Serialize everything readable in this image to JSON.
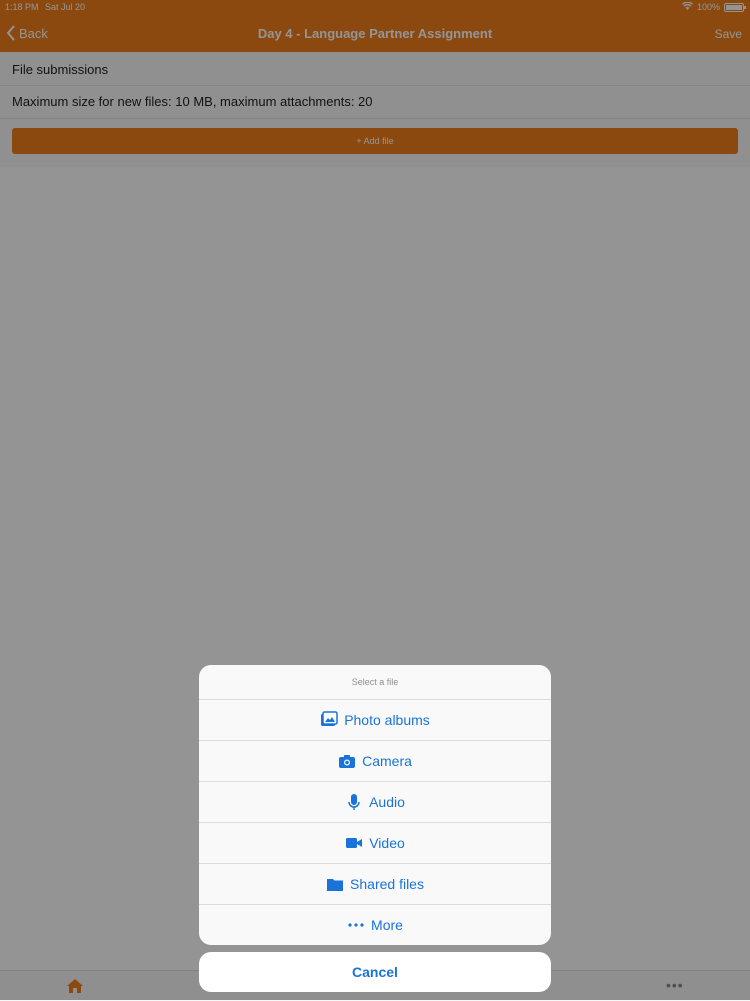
{
  "status": {
    "time": "1:18 PM",
    "date": "Sat Jul 20",
    "battery": "100%",
    "battery_fraction": 1.0
  },
  "nav": {
    "back_label": "Back",
    "title": "Day 4 - Language Partner Assignment",
    "save_label": "Save"
  },
  "content": {
    "section_title": "File submissions",
    "limits": "Maximum size for new files: 10 MB, maximum attachments: 20",
    "add_file_label": "+ Add file"
  },
  "sheet": {
    "header": "Select a file",
    "items": [
      {
        "label": "Photo albums",
        "icon": "photo-albums-icon"
      },
      {
        "label": "Camera",
        "icon": "camera-icon"
      },
      {
        "label": "Audio",
        "icon": "microphone-icon"
      },
      {
        "label": "Video",
        "icon": "video-icon"
      },
      {
        "label": "Shared files",
        "icon": "folder-icon"
      },
      {
        "label": "More",
        "icon": "more-dots-icon"
      }
    ],
    "cancel_label": "Cancel"
  },
  "colors": {
    "brand": "#f07f1d",
    "action": "#1a73d9"
  }
}
